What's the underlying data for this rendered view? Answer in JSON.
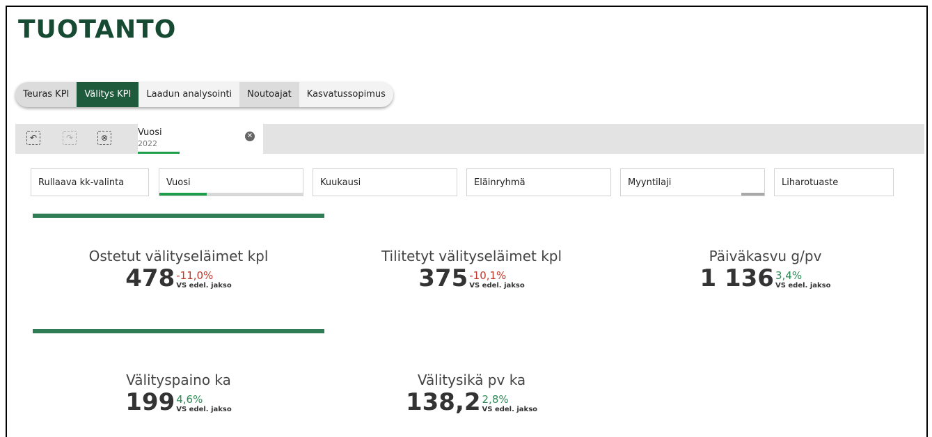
{
  "title": "TUOTANTO",
  "tabs": [
    {
      "label": "Teuras KPI"
    },
    {
      "label": "Välitys KPI"
    },
    {
      "label": "Laadun analysointi"
    },
    {
      "label": "Noutoajat"
    },
    {
      "label": "Kasvatussopimus"
    }
  ],
  "toolbar": {
    "icons": [
      "back-icon",
      "forward-icon",
      "clear-selections-icon"
    ],
    "selection": {
      "label": "Vuosi",
      "value": "2022"
    }
  },
  "filters": [
    {
      "label": "Rullaava kk-valinta",
      "fill": 0
    },
    {
      "label": "Vuosi",
      "fill": 0.33
    },
    {
      "label": "Kuukausi",
      "fill": 0
    },
    {
      "label": "Eläinryhmä",
      "fill": 0
    },
    {
      "label": "Myyntilaji",
      "fill": 0
    },
    {
      "label": "Liharotuaste",
      "fill": 0
    }
  ],
  "kpis": [
    {
      "title": "Ostetut välityseläimet kpl",
      "value": "478",
      "delta": "-11,0%",
      "vs": "VS edel. jakso"
    },
    {
      "title": "Tilitetyt välityseläimet kpl",
      "value": "375",
      "delta": "-10,1%",
      "vs": "VS edel. jakso"
    },
    {
      "title": "Päiväkasvu g/pv",
      "value": "1 136",
      "delta": "3,4%",
      "vs": "VS edel. jakso"
    },
    {
      "title": "Välityspaino ka",
      "value": "199",
      "delta": "4,6%",
      "vs": "VS edel. jakso"
    },
    {
      "title": "Välitysikä pv ka",
      "value": "138,2",
      "delta": "2,8%",
      "vs": "VS edel. jakso"
    }
  ],
  "colors": {
    "brand": "#174a33",
    "active_tab": "#1d5b3c",
    "negative": "#c0392b",
    "positive": "#2e8b57",
    "selection_bar": "#1e9e4a"
  }
}
